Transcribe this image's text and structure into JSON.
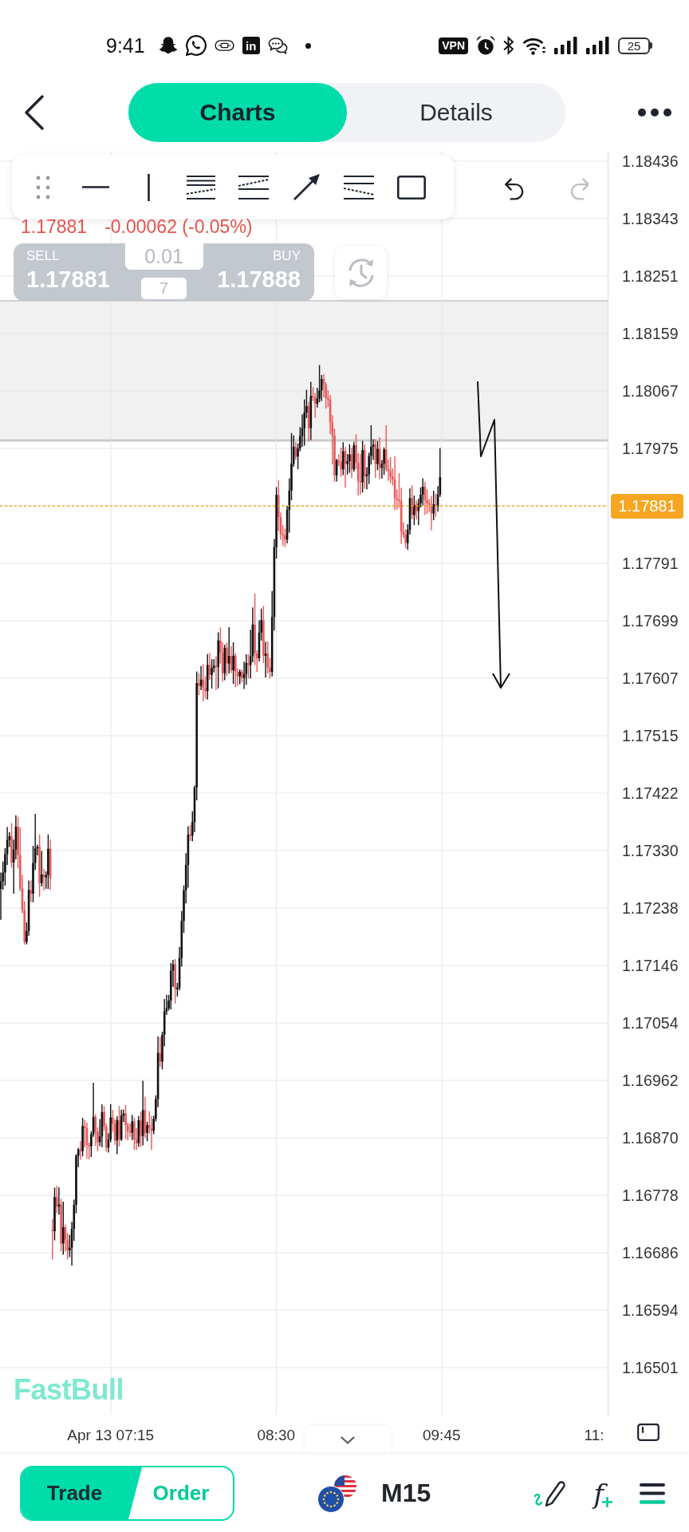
{
  "status_bar": {
    "time": "9:41",
    "app_badge": "in",
    "vpn": "VPN",
    "battery": "25"
  },
  "nav": {
    "tabs": [
      {
        "label": "Charts",
        "selected": true
      },
      {
        "label": "Details",
        "selected": false
      }
    ]
  },
  "history_buttons": [
    {
      "kind": "undo",
      "disabled": false
    },
    {
      "kind": "redo",
      "disabled": true
    }
  ],
  "quote": {
    "price": "1.17881",
    "change": "-0.00062 (-0.05%)"
  },
  "trade_panel": {
    "disabled": true,
    "sell_label": "SELL",
    "sell_price": "1.17881",
    "lot": "0.01",
    "spread": "7",
    "buy_label": "BUY",
    "buy_price": "1.17888"
  },
  "price_axis": [
    {
      "kind": "tick",
      "text": "1.18436"
    },
    {
      "kind": "tick",
      "text": "1.18343"
    },
    {
      "kind": "tick",
      "text": "1.18251"
    },
    {
      "kind": "tick",
      "text": "1.18159"
    },
    {
      "kind": "tick",
      "text": "1.18067"
    },
    {
      "kind": "tick",
      "text": "1.17975"
    },
    {
      "kind": "current",
      "text": "1.17881"
    },
    {
      "kind": "tick",
      "text": "1.17791"
    },
    {
      "kind": "tick",
      "text": "1.17699"
    },
    {
      "kind": "tick",
      "text": "1.17607"
    },
    {
      "kind": "tick",
      "text": "1.17515"
    },
    {
      "kind": "tick",
      "text": "1.17422"
    },
    {
      "kind": "tick",
      "text": "1.17330"
    },
    {
      "kind": "tick",
      "text": "1.17238"
    },
    {
      "kind": "tick",
      "text": "1.17146"
    },
    {
      "kind": "tick",
      "text": "1.17054"
    },
    {
      "kind": "tick",
      "text": "1.16962"
    },
    {
      "kind": "tick",
      "text": "1.16870"
    },
    {
      "kind": "tick",
      "text": "1.16778"
    },
    {
      "kind": "tick",
      "text": "1.16686"
    },
    {
      "kind": "tick",
      "text": "1.16594"
    },
    {
      "kind": "tick",
      "text": "1.16501"
    }
  ],
  "time_axis": [
    "Apr 13 07:15",
    "08:30",
    "09:45",
    "11:"
  ],
  "logo": "FastBull",
  "bottom_bar": {
    "tabs": [
      {
        "label": "Trade",
        "selected": true
      },
      {
        "label": "Order",
        "selected": false
      }
    ],
    "timeframe": "M15",
    "indicator_symbol": "f"
  }
}
